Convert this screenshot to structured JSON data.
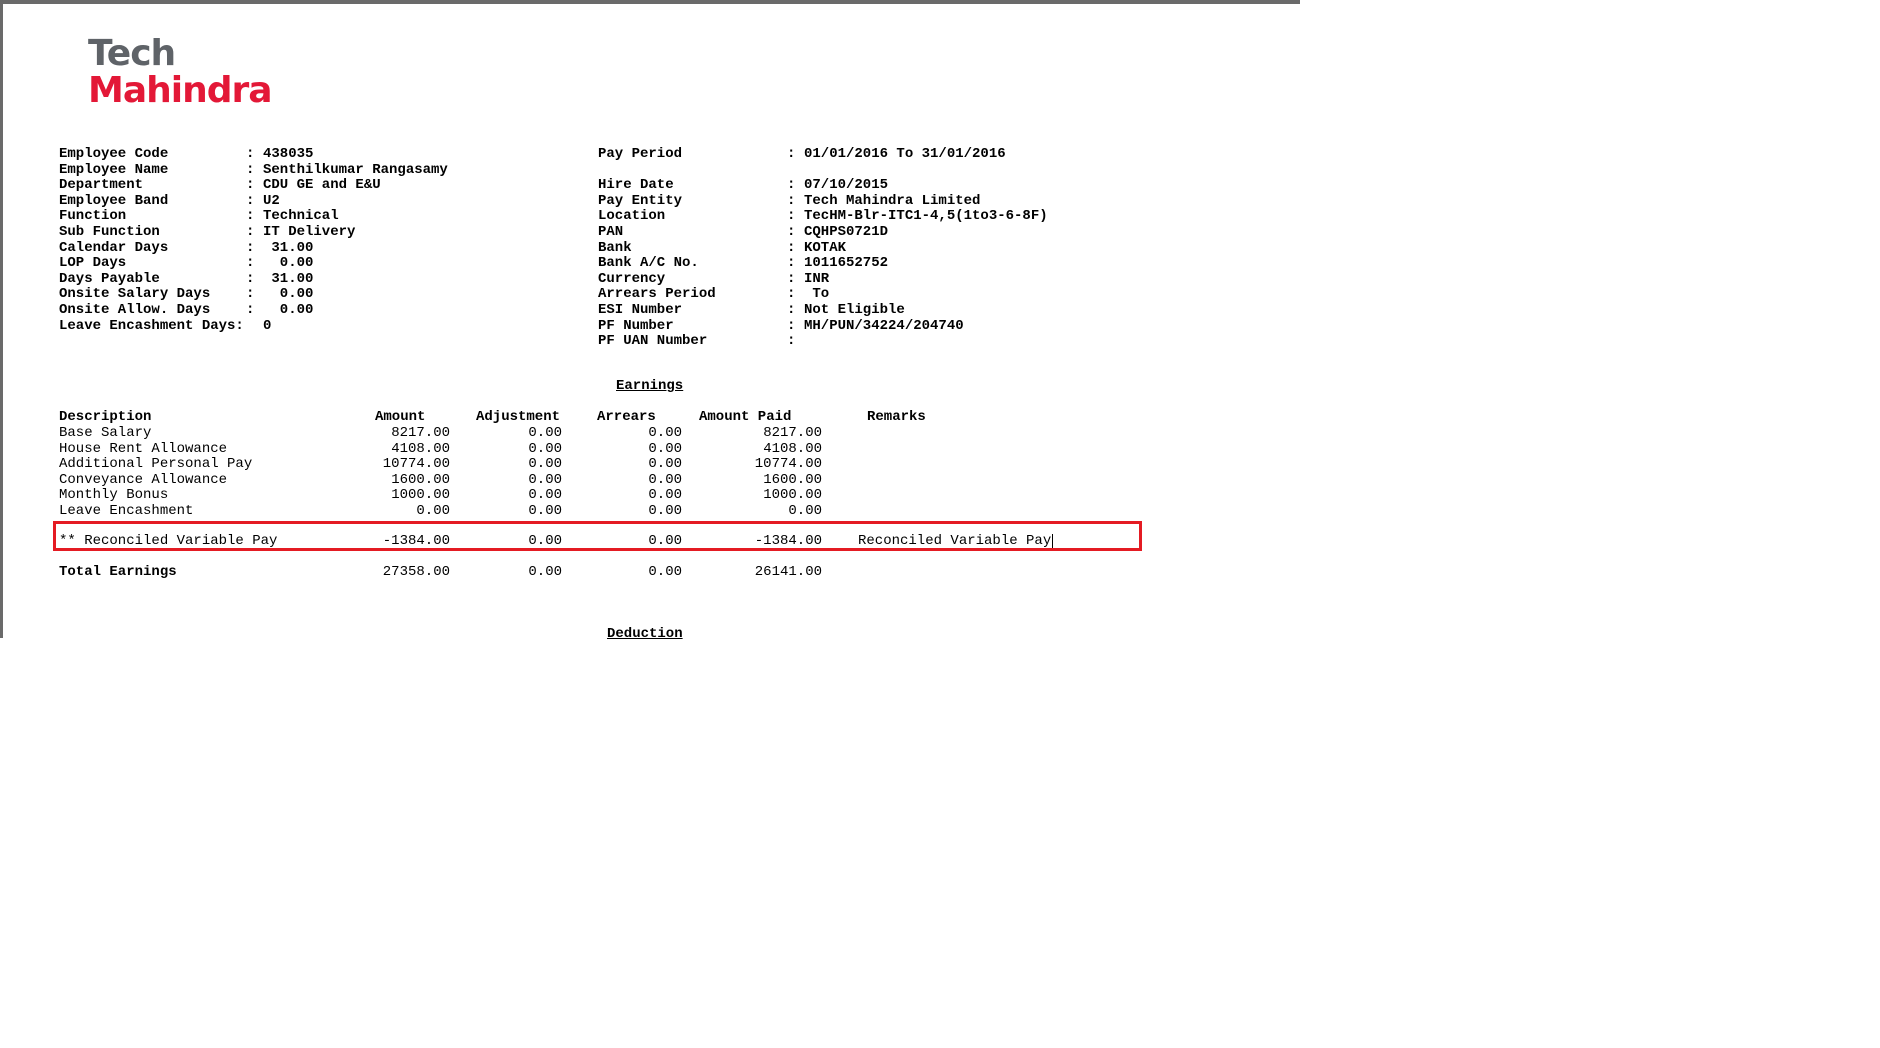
{
  "company": {
    "name_line1": "Tech",
    "name_line2": "Mahindra"
  },
  "employee_left": [
    {
      "label": "Employee Code",
      "sep": ":",
      "value": "438035"
    },
    {
      "label": "Employee Name",
      "sep": ":",
      "value": "Senthilkumar Rangasamy"
    },
    {
      "label": "Department",
      "sep": ":",
      "value": "CDU GE and E&U"
    },
    {
      "label": "Employee Band",
      "sep": ":",
      "value": "U2"
    },
    {
      "label": "Function",
      "sep": ":",
      "value": "Technical"
    },
    {
      "label": "Sub Function",
      "sep": ":",
      "value": "IT Delivery"
    },
    {
      "label": "Calendar Days",
      "sep": ":",
      "value": " 31.00"
    },
    {
      "label": "LOP Days",
      "sep": ":",
      "value": "  0.00"
    },
    {
      "label": "Days Payable",
      "sep": ":",
      "value": " 31.00"
    },
    {
      "label": "Onsite Salary Days",
      "sep": ":",
      "value": "  0.00"
    },
    {
      "label": "Onsite Allow. Days",
      "sep": ":",
      "value": "  0.00"
    },
    {
      "label": "Leave Encashment Days:",
      "sep": "",
      "value": "0"
    }
  ],
  "employee_right": [
    {
      "label": "Pay Period",
      "sep": ":",
      "value": "01/01/2016 To 31/01/2016"
    },
    {
      "label": "",
      "sep": "",
      "value": ""
    },
    {
      "label": "Hire Date",
      "sep": ":",
      "value": "07/10/2015"
    },
    {
      "label": "Pay Entity",
      "sep": ":",
      "value": "Tech Mahindra Limited"
    },
    {
      "label": "Location",
      "sep": ":",
      "value": "TecHM-Blr-ITC1-4,5(1to3-6-8F)"
    },
    {
      "label": "PAN",
      "sep": ":",
      "value": "CQHPS0721D"
    },
    {
      "label": "Bank",
      "sep": ":",
      "value": "KOTAK"
    },
    {
      "label": "Bank A/C No.",
      "sep": ":",
      "value": "1011652752"
    },
    {
      "label": "Currency",
      "sep": ":",
      "value": "INR"
    },
    {
      "label": "Arrears Period",
      "sep": ":",
      "value": " To"
    },
    {
      "label": "ESI Number",
      "sep": ":",
      "value": "Not Eligible"
    },
    {
      "label": "PF Number",
      "sep": ":",
      "value": "MH/PUN/34224/204740"
    },
    {
      "label": "PF UAN Number",
      "sep": ":",
      "value": ""
    }
  ],
  "earnings": {
    "title": "Earnings",
    "headers": {
      "description": "Description",
      "amount": "Amount",
      "adjustment": "Adjustment",
      "arrears": "Arrears",
      "amount_paid": "Amount Paid",
      "remarks": "Remarks"
    },
    "rows": [
      {
        "description": "Base Salary",
        "amount": "8217.00",
        "adjustment": "0.00",
        "arrears": "0.00",
        "amount_paid": "8217.00",
        "remarks": ""
      },
      {
        "description": "House Rent Allowance",
        "amount": "4108.00",
        "adjustment": "0.00",
        "arrears": "0.00",
        "amount_paid": "4108.00",
        "remarks": ""
      },
      {
        "description": "Additional Personal Pay",
        "amount": "10774.00",
        "adjustment": "0.00",
        "arrears": "0.00",
        "amount_paid": "10774.00",
        "remarks": ""
      },
      {
        "description": "Conveyance Allowance",
        "amount": "1600.00",
        "adjustment": "0.00",
        "arrears": "0.00",
        "amount_paid": "1600.00",
        "remarks": ""
      },
      {
        "description": "Monthly Bonus",
        "amount": "1000.00",
        "adjustment": "0.00",
        "arrears": "0.00",
        "amount_paid": "1000.00",
        "remarks": ""
      },
      {
        "description": "Leave Encashment",
        "amount": "0.00",
        "adjustment": "0.00",
        "arrears": "0.00",
        "amount_paid": "0.00",
        "remarks": ""
      },
      {
        "description": "** Reconciled Variable Pay",
        "amount": "-1384.00",
        "adjustment": "0.00",
        "arrears": "0.00",
        "amount_paid": "-1384.00",
        "remarks": "Reconciled Variable Pay"
      }
    ],
    "total": {
      "description": "Total Earnings",
      "amount": "27358.00",
      "adjustment": "0.00",
      "arrears": "0.00",
      "amount_paid": "26141.00"
    }
  },
  "deduction": {
    "title": "Deduction"
  },
  "colors": {
    "highlight_border": "#e41b23",
    "logo_red": "#e31837",
    "logo_grey": "#5f6368"
  }
}
